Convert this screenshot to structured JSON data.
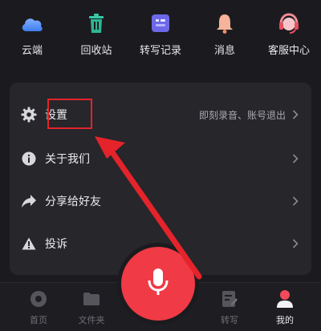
{
  "quick_actions": [
    {
      "label": "云端",
      "icon": "cloud-icon"
    },
    {
      "label": "回收站",
      "icon": "trash-icon"
    },
    {
      "label": "转写记录",
      "icon": "transcript-records-icon"
    },
    {
      "label": "消息",
      "icon": "bell-icon"
    },
    {
      "label": "客服中心",
      "icon": "headset-icon"
    }
  ],
  "menu": {
    "settings": {
      "label": "设置",
      "hint": "即刻录音、账号退出"
    },
    "about": {
      "label": "关于我们"
    },
    "share": {
      "label": "分享给好友"
    },
    "complaint": {
      "label": "投诉"
    }
  },
  "bottom_nav": {
    "home": "首页",
    "folder": "文件夹",
    "transcribe": "转写",
    "mine": "我的"
  },
  "colors": {
    "background": "#1b1b1f",
    "card": "#26262b",
    "record": "#f03a45",
    "annotation": "#e4232b"
  }
}
